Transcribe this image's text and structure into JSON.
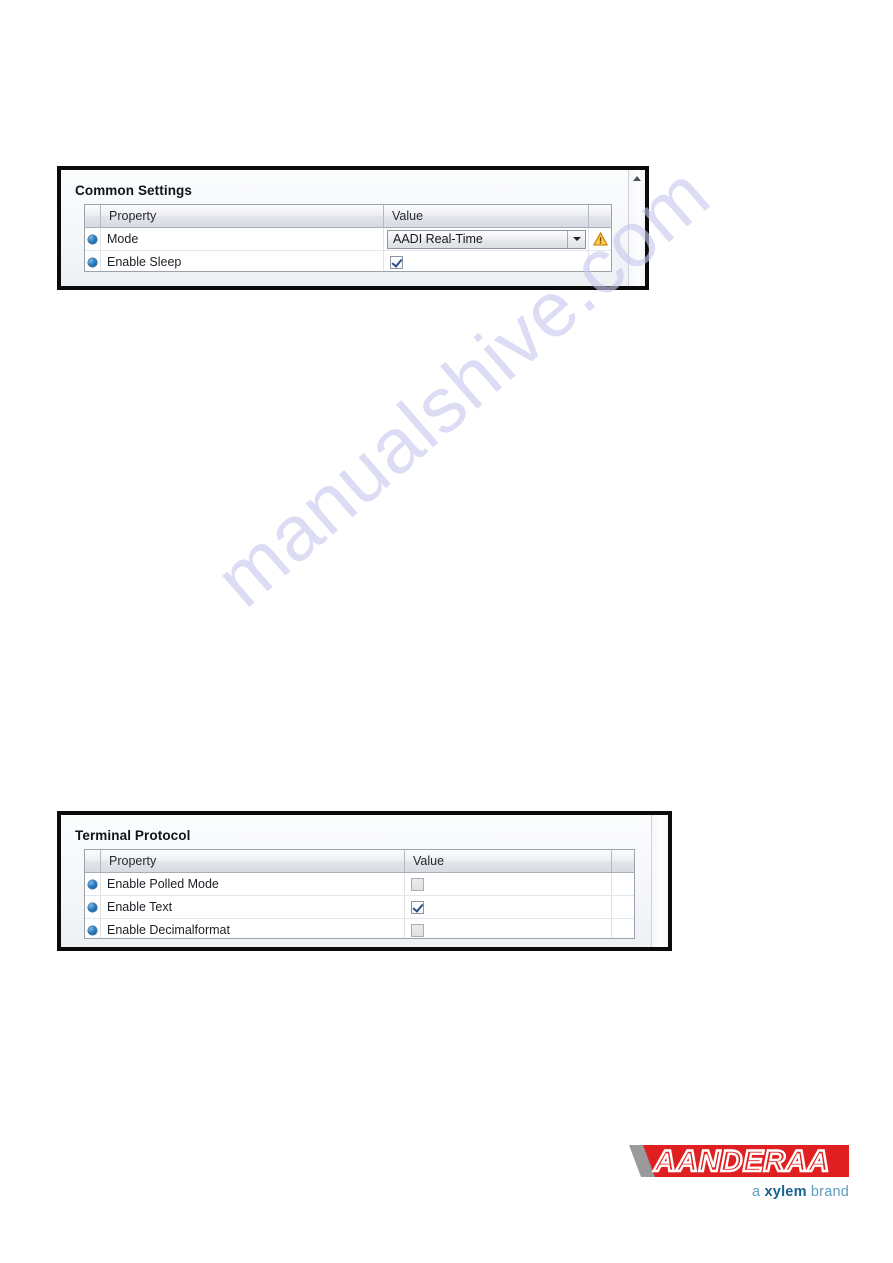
{
  "document": {
    "watermark": "manualshive.com",
    "background_color": "#ffffff"
  },
  "panels": [
    {
      "id": "common-settings",
      "title": "Common Settings",
      "columns": [
        "Property",
        "Value"
      ],
      "scrollbar": {
        "visible": true,
        "up_arrow": "scroll-up-arrow"
      },
      "rows": [
        {
          "bullet": "blue-dot-icon",
          "property": "Mode",
          "control": "dropdown",
          "value": "AADI Real-Time",
          "dropdown_arrow": "chevron-down-icon",
          "status_icon": "warning-triangle-icon"
        },
        {
          "bullet": "blue-dot-icon",
          "property": "Enable Sleep",
          "control": "checkbox",
          "checked": true,
          "enabled": true
        }
      ]
    },
    {
      "id": "terminal-protocol",
      "title": "Terminal Protocol",
      "columns": [
        "Property",
        "Value"
      ],
      "scrollbar": {
        "visible": true,
        "up_arrow": null
      },
      "rows": [
        {
          "bullet": "blue-dot-icon",
          "property": "Enable Polled Mode",
          "control": "checkbox",
          "checked": false,
          "enabled": false
        },
        {
          "bullet": "blue-dot-icon",
          "property": "Enable Text",
          "control": "checkbox",
          "checked": true,
          "enabled": true
        },
        {
          "bullet": "blue-dot-icon",
          "property": "Enable Decimalformat",
          "control": "checkbox",
          "checked": false,
          "enabled": false
        }
      ]
    }
  ],
  "logo": {
    "wordmark": "AANDERAA",
    "tagline_prefix": "a ",
    "tagline_brand": "xylem",
    "tagline_suffix": " brand",
    "banner_color": "#e02020",
    "wedge_color": "#9a9a9a",
    "brand_color": "#14628f",
    "tagline_color": "#5e9cc4"
  }
}
